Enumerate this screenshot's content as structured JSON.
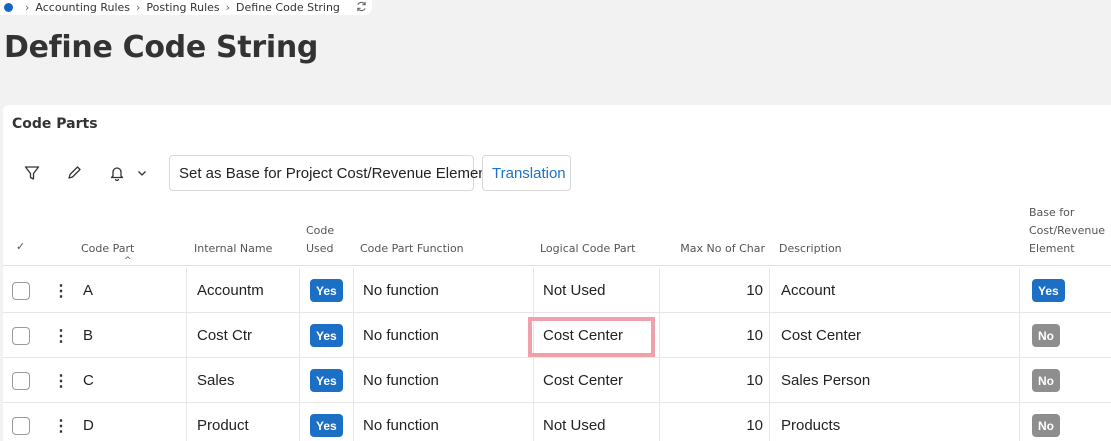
{
  "breadcrumb": {
    "items": [
      "Accounting Rules",
      "Posting Rules",
      "Define Code String"
    ]
  },
  "page": {
    "title": "Define Code String"
  },
  "section": {
    "title": "Code Parts"
  },
  "toolbar": {
    "set_base_label": "Set as Base for Project Cost/Revenue Element",
    "translation_label": "Translation"
  },
  "columns": {
    "select": "✓",
    "code_part": "Code Part",
    "internal_name": "Internal Name",
    "code_used_1": "Code",
    "code_used_2": "Used",
    "function": "Code Part Function",
    "logical": "Logical Code Part",
    "max_char": "Max No of Char",
    "description": "Description",
    "base_1": "Base for",
    "base_2": "Cost/Revenue",
    "base_3": "Element"
  },
  "rows": [
    {
      "code_part": "A",
      "internal_name": "Accountm",
      "code_used": "Yes",
      "function": "No function",
      "logical": "Not Used",
      "max_char": "10",
      "description": "Account",
      "base": "Yes"
    },
    {
      "code_part": "B",
      "internal_name": "Cost Ctr",
      "code_used": "Yes",
      "function": "No function",
      "logical": "Cost Center",
      "max_char": "10",
      "description": "Cost Center",
      "base": "No"
    },
    {
      "code_part": "C",
      "internal_name": "Sales",
      "code_used": "Yes",
      "function": "No function",
      "logical": "Cost Center",
      "max_char": "10",
      "description": "Sales Person",
      "base": "No"
    },
    {
      "code_part": "D",
      "internal_name": "Product",
      "code_used": "Yes",
      "function": "No function",
      "logical": "Not Used",
      "max_char": "10",
      "description": "Products",
      "base": "No"
    }
  ],
  "colors": {
    "accent": "#1b6fc4",
    "no_badge": "#8e8e8e",
    "highlight": "#f0a0a8"
  },
  "icons": [
    "filter-icon",
    "edit-icon",
    "bell-icon",
    "chevron-down-icon",
    "refresh-icon",
    "kebab-icon"
  ]
}
